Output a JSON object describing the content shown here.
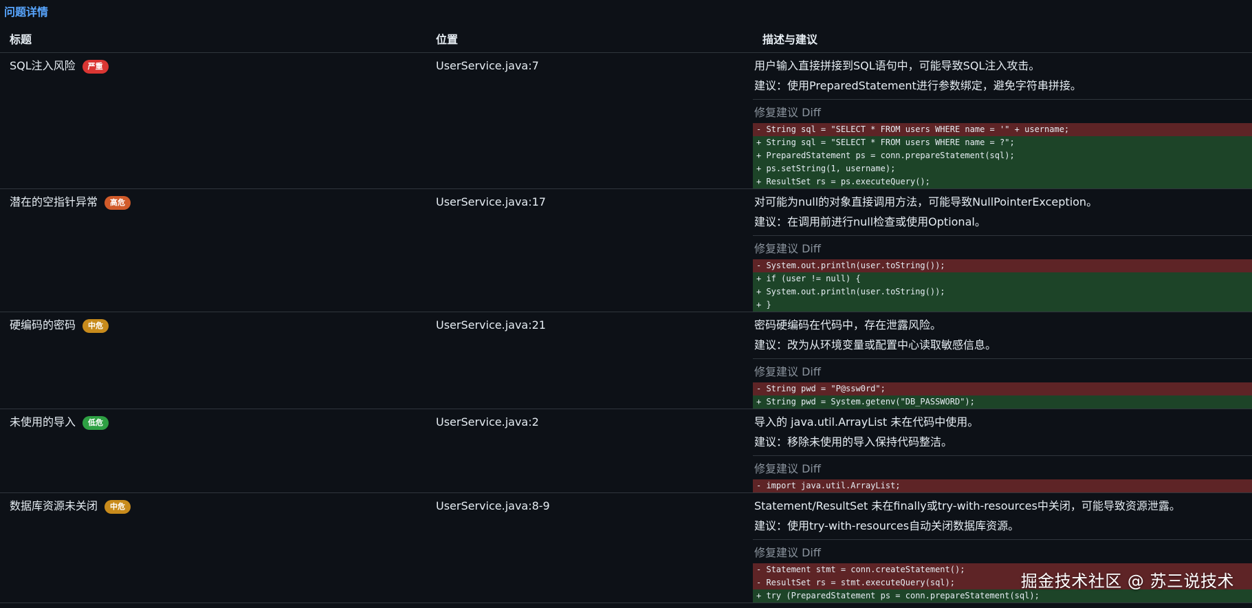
{
  "section_title": "问题详情",
  "columns": [
    "标题",
    "位置",
    "描述与建议"
  ],
  "colors": {
    "link_blue": "#58a6ff",
    "severity_critical": "#da3633",
    "severity_high": "#d15b2a",
    "severity_medium": "#c88b1c",
    "severity_low": "#2ea043",
    "diff_removed_bg": "#5e2426",
    "diff_added_bg": "#1d4428"
  },
  "diff_title": "修复建议 Diff",
  "issues": [
    {
      "title": "SQL注入风险",
      "severity": "严重",
      "severity_color": "#da3633",
      "location": "UserService.java:7",
      "description": "用户输入直接拼接到SQL语句中，可能导致SQL注入攻击。",
      "suggestion": "建议：使用PreparedStatement进行参数绑定，避免字符串拼接。",
      "diff": [
        {
          "type": "del",
          "text": "- String sql = \"SELECT * FROM users WHERE name = '\" + username;"
        },
        {
          "type": "add",
          "text": "+ String sql = \"SELECT * FROM users WHERE name = ?\";"
        },
        {
          "type": "add",
          "text": "+ PreparedStatement ps = conn.prepareStatement(sql);"
        },
        {
          "type": "add",
          "text": "+ ps.setString(1, username);"
        },
        {
          "type": "add",
          "text": "+ ResultSet rs = ps.executeQuery();"
        }
      ]
    },
    {
      "title": "潜在的空指针异常",
      "severity": "高危",
      "severity_color": "#d15b2a",
      "location": "UserService.java:17",
      "description": "对可能为null的对象直接调用方法，可能导致NullPointerException。",
      "suggestion": "建议：在调用前进行null检查或使用Optional。",
      "diff": [
        {
          "type": "del",
          "text": "- System.out.println(user.toString());"
        },
        {
          "type": "add",
          "text": "+ if (user != null) {"
        },
        {
          "type": "add",
          "text": "+ System.out.println(user.toString());"
        },
        {
          "type": "add",
          "text": "+ }"
        }
      ]
    },
    {
      "title": "硬编码的密码",
      "severity": "中危",
      "severity_color": "#c88b1c",
      "location": "UserService.java:21",
      "description": "密码硬编码在代码中，存在泄露风险。",
      "suggestion": "建议：改为从环境变量或配置中心读取敏感信息。",
      "diff": [
        {
          "type": "del",
          "text": "- String pwd = \"P@ssw0rd\";"
        },
        {
          "type": "add",
          "text": "+ String pwd = System.getenv(\"DB_PASSWORD\");"
        }
      ]
    },
    {
      "title": "未使用的导入",
      "severity": "低危",
      "severity_color": "#2ea043",
      "location": "UserService.java:2",
      "description": "导入的 java.util.ArrayList 未在代码中使用。",
      "suggestion": "建议：移除未使用的导入保持代码整洁。",
      "diff": [
        {
          "type": "del",
          "text": "- import java.util.ArrayList;"
        }
      ]
    },
    {
      "title": "数据库资源未关闭",
      "severity": "中危",
      "severity_color": "#c88b1c",
      "location": "UserService.java:8-9",
      "description": "Statement/ResultSet 未在finally或try-with-resources中关闭，可能导致资源泄露。",
      "suggestion": "建议：使用try-with-resources自动关闭数据库资源。",
      "diff": [
        {
          "type": "del",
          "text": "- Statement stmt = conn.createStatement();"
        },
        {
          "type": "del",
          "text": "- ResultSet rs = stmt.executeQuery(sql);"
        },
        {
          "type": "add",
          "text": "+ try (PreparedStatement ps = conn.prepareStatement(sql);"
        }
      ]
    }
  ],
  "watermark": "掘金技术社区 @ 苏三说技术"
}
